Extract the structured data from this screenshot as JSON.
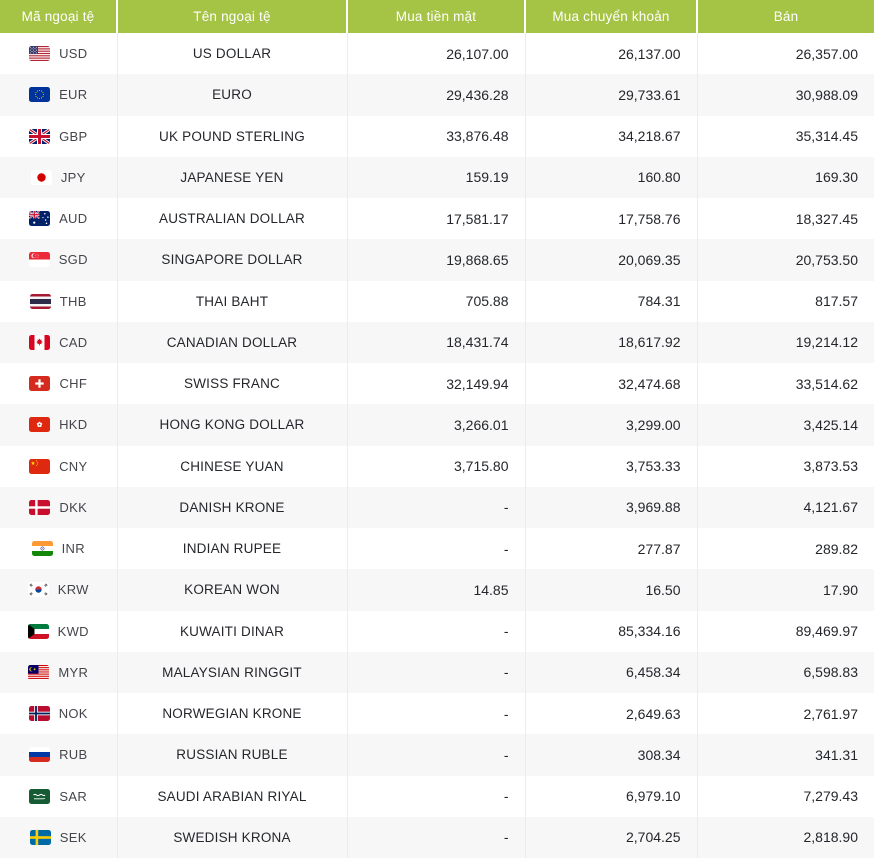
{
  "colors": {
    "header_bg": "#a5c344",
    "header_text": "#ffffff",
    "row_alt_bg": "#f7f7f8",
    "body_text": "#24262b"
  },
  "table": {
    "columns": [
      "Mã ngoại tệ",
      "Tên ngoại tệ",
      "Mua tiền mặt",
      "Mua chuyển khoản",
      "Bán"
    ],
    "rows": [
      {
        "code": "USD",
        "flag": "us-flag-icon",
        "name": "US DOLLAR",
        "cash_buy": "26,107.00",
        "transfer_buy": "26,137.00",
        "sell": "26,357.00"
      },
      {
        "code": "EUR",
        "flag": "eu-flag-icon",
        "name": "EURO",
        "cash_buy": "29,436.28",
        "transfer_buy": "29,733.61",
        "sell": "30,988.09"
      },
      {
        "code": "GBP",
        "flag": "uk-flag-icon",
        "name": "UK POUND STERLING",
        "cash_buy": "33,876.48",
        "transfer_buy": "34,218.67",
        "sell": "35,314.45"
      },
      {
        "code": "JPY",
        "flag": "japan-flag-icon",
        "name": "JAPANESE YEN",
        "cash_buy": "159.19",
        "transfer_buy": "160.80",
        "sell": "169.30"
      },
      {
        "code": "AUD",
        "flag": "australia-flag-icon",
        "name": "AUSTRALIAN DOLLAR",
        "cash_buy": "17,581.17",
        "transfer_buy": "17,758.76",
        "sell": "18,327.45"
      },
      {
        "code": "SGD",
        "flag": "singapore-flag-icon",
        "name": "SINGAPORE DOLLAR",
        "cash_buy": "19,868.65",
        "transfer_buy": "20,069.35",
        "sell": "20,753.50"
      },
      {
        "code": "THB",
        "flag": "thailand-flag-icon",
        "name": "THAI BAHT",
        "cash_buy": "705.88",
        "transfer_buy": "784.31",
        "sell": "817.57"
      },
      {
        "code": "CAD",
        "flag": "canada-flag-icon",
        "name": "CANADIAN DOLLAR",
        "cash_buy": "18,431.74",
        "transfer_buy": "18,617.92",
        "sell": "19,214.12"
      },
      {
        "code": "CHF",
        "flag": "switzerland-flag-icon",
        "name": "SWISS FRANC",
        "cash_buy": "32,149.94",
        "transfer_buy": "32,474.68",
        "sell": "33,514.62"
      },
      {
        "code": "HKD",
        "flag": "hong-kong-flag-icon",
        "name": "HONG KONG DOLLAR",
        "cash_buy": "3,266.01",
        "transfer_buy": "3,299.00",
        "sell": "3,425.14"
      },
      {
        "code": "CNY",
        "flag": "china-flag-icon",
        "name": "CHINESE YUAN",
        "cash_buy": "3,715.80",
        "transfer_buy": "3,753.33",
        "sell": "3,873.53"
      },
      {
        "code": "DKK",
        "flag": "denmark-flag-icon",
        "name": "DANISH KRONE",
        "cash_buy": "-",
        "transfer_buy": "3,969.88",
        "sell": "4,121.67"
      },
      {
        "code": "INR",
        "flag": "india-flag-icon",
        "name": "INDIAN RUPEE",
        "cash_buy": "-",
        "transfer_buy": "277.87",
        "sell": "289.82"
      },
      {
        "code": "KRW",
        "flag": "south-korea-flag-icon",
        "name": "KOREAN WON",
        "cash_buy": "14.85",
        "transfer_buy": "16.50",
        "sell": "17.90"
      },
      {
        "code": "KWD",
        "flag": "kuwait-flag-icon",
        "name": "KUWAITI DINAR",
        "cash_buy": "-",
        "transfer_buy": "85,334.16",
        "sell": "89,469.97"
      },
      {
        "code": "MYR",
        "flag": "malaysia-flag-icon",
        "name": "MALAYSIAN RINGGIT",
        "cash_buy": "-",
        "transfer_buy": "6,458.34",
        "sell": "6,598.83"
      },
      {
        "code": "NOK",
        "flag": "norway-flag-icon",
        "name": "NORWEGIAN KRONE",
        "cash_buy": "-",
        "transfer_buy": "2,649.63",
        "sell": "2,761.97"
      },
      {
        "code": "RUB",
        "flag": "russia-flag-icon",
        "name": "RUSSIAN RUBLE",
        "cash_buy": "-",
        "transfer_buy": "308.34",
        "sell": "341.31"
      },
      {
        "code": "SAR",
        "flag": "saudi-arabia-flag-icon",
        "name": "SAUDI ARABIAN RIYAL",
        "cash_buy": "-",
        "transfer_buy": "6,979.10",
        "sell": "7,279.43"
      },
      {
        "code": "SEK",
        "flag": "sweden-flag-icon",
        "name": "SWEDISH KRONA",
        "cash_buy": "-",
        "transfer_buy": "2,704.25",
        "sell": "2,818.90"
      }
    ]
  }
}
